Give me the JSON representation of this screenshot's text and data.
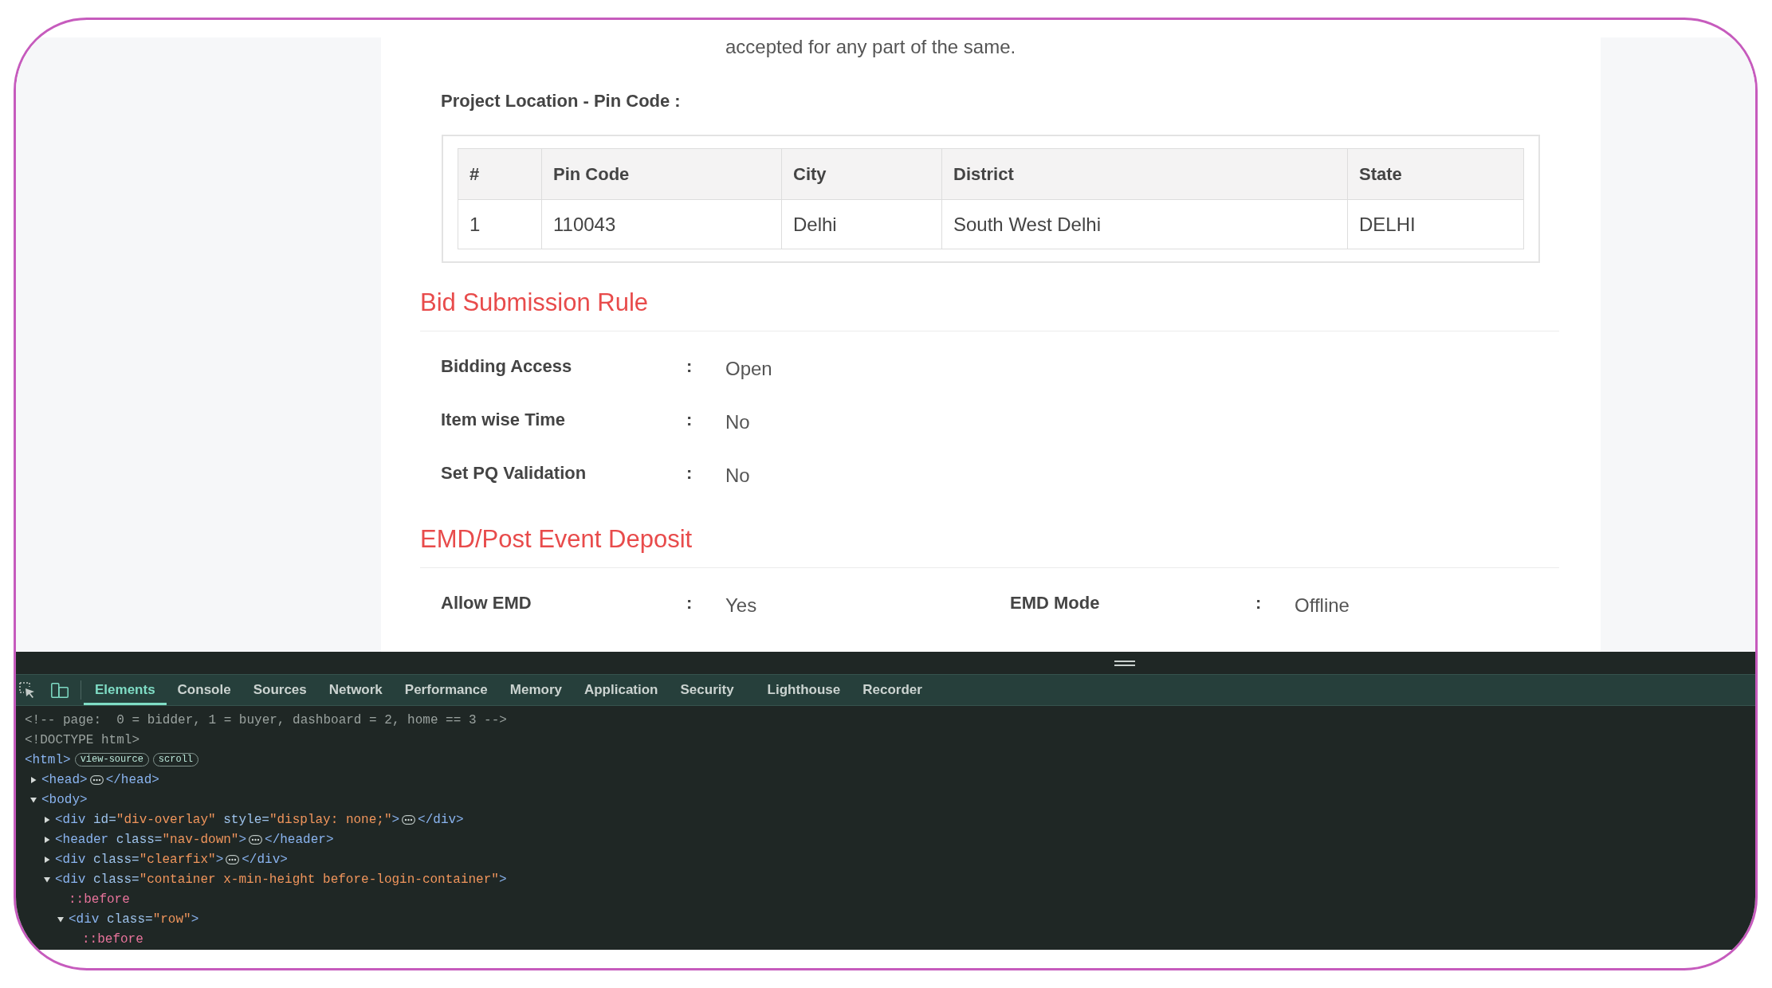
{
  "page": {
    "intro_text": "accepted for any part of the same.",
    "pin_code": {
      "label": "Project Location - Pin Code :",
      "table": {
        "columns": [
          "#",
          "Pin Code",
          "City",
          "District",
          "State"
        ],
        "rows": [
          [
            "1",
            "110043",
            "Delhi",
            "South West Delhi",
            "DELHI"
          ]
        ]
      }
    },
    "sections": [
      {
        "title": "Bid Submission Rule",
        "rows": [
          {
            "fields": [
              {
                "label": "Bidding Access",
                "separator": ":",
                "value": "Open"
              }
            ]
          },
          {
            "fields": [
              {
                "label": "Item wise Time",
                "separator": ":",
                "value": "No"
              }
            ]
          },
          {
            "fields": [
              {
                "label": "Set PQ Validation",
                "separator": ":",
                "value": "No"
              }
            ]
          }
        ]
      },
      {
        "title": "EMD/Post Event Deposit",
        "rows": [
          {
            "fields": [
              {
                "label": "Allow EMD",
                "separator": ":",
                "value": "Yes"
              },
              {
                "label": "EMD Mode",
                "separator": ":",
                "value": "Offline"
              }
            ]
          }
        ]
      }
    ]
  },
  "devtools": {
    "tabs": [
      {
        "label": "Elements",
        "selected": true
      },
      {
        "label": "Console",
        "selected": false
      },
      {
        "label": "Sources",
        "selected": false
      },
      {
        "label": "Network",
        "selected": false
      },
      {
        "label": "Performance",
        "selected": false
      },
      {
        "label": "Memory",
        "selected": false
      },
      {
        "label": "Application",
        "selected": false
      },
      {
        "label": "Security",
        "selected": false
      },
      {
        "label": "Lighthouse",
        "selected": false
      },
      {
        "label": "Recorder",
        "selected": false
      }
    ],
    "dom_tree": [
      {
        "kind": "comment",
        "text": "<!-- page:  0 = bidder, 1 = buyer, dashboard = 2, home == 3 -->"
      },
      {
        "kind": "doctype",
        "text": "<!DOCTYPE html>"
      },
      {
        "kind": "root",
        "open": "<html",
        "end": ">",
        "badges": [
          "view-source",
          "scroll"
        ],
        "children": [
          {
            "kind": "element",
            "expanded": false,
            "open": "<head",
            "end": ">",
            "close": "</head>"
          },
          {
            "kind": "element",
            "expanded": true,
            "open": "<body",
            "end": ">",
            "children": [
              {
                "kind": "element",
                "expanded": false,
                "open": "<div",
                "attributes": [
                  {
                    "name": "id=",
                    "value": "\"div-overlay\""
                  },
                  {
                    "name": "style=",
                    "value": "\"display: none;\""
                  }
                ],
                "end": ">",
                "close": "</div>"
              },
              {
                "kind": "element",
                "expanded": false,
                "open": "<header",
                "attributes": [
                  {
                    "name": "class=",
                    "value": "\"nav-down\""
                  }
                ],
                "end": ">",
                "close": "</header>"
              },
              {
                "kind": "element",
                "expanded": false,
                "open": "<div",
                "attributes": [
                  {
                    "name": "class=",
                    "value": "\"clearfix\""
                  }
                ],
                "end": ">",
                "close": "</div>"
              },
              {
                "kind": "element",
                "expanded": true,
                "open": "<div",
                "attributes": [
                  {
                    "name": "class=",
                    "value": "\"container x-min-height before-login-container\""
                  }
                ],
                "end": ">",
                "children": [
                  {
                    "kind": "pseudo",
                    "text": "::before"
                  },
                  {
                    "kind": "element",
                    "expanded": true,
                    "open": "<div",
                    "attributes": [
                      {
                        "name": "class=",
                        "value": "\"row\""
                      }
                    ],
                    "end": ">",
                    "children": [
                      {
                        "kind": "pseudo",
                        "text": "::before"
                      }
                    ]
                  }
                ]
              }
            ]
          }
        ]
      }
    ]
  }
}
